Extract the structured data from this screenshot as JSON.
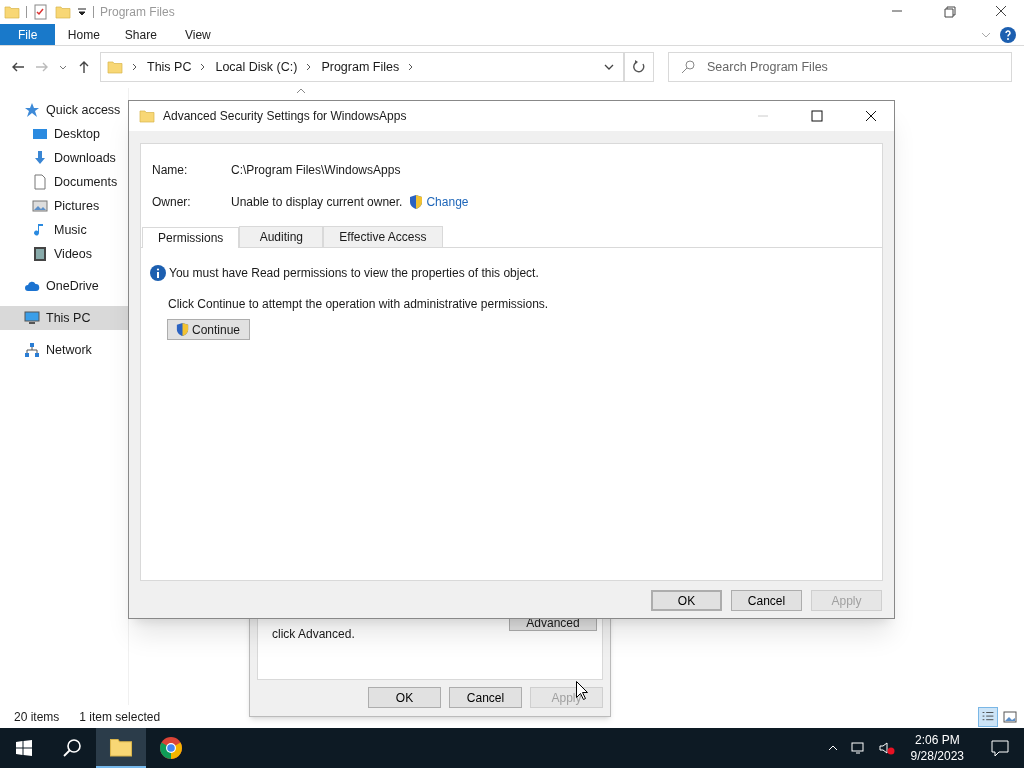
{
  "explorer": {
    "title": "Program Files",
    "ribbon_tabs": [
      {
        "label": "File",
        "selected": true
      },
      {
        "label": "Home",
        "selected": false
      },
      {
        "label": "Share",
        "selected": false
      },
      {
        "label": "View",
        "selected": false
      }
    ],
    "breadcrumb": [
      "This PC",
      "Local Disk (C:)",
      "Program Files"
    ],
    "search": {
      "placeholder": "Search Program Files"
    },
    "sidebar": [
      {
        "label": "Quick access",
        "kind": "star",
        "selected": false,
        "children": [
          {
            "label": "Desktop",
            "kind": "desktop",
            "selected": false
          },
          {
            "label": "Downloads",
            "kind": "download",
            "selected": false
          },
          {
            "label": "Documents",
            "kind": "document",
            "selected": false
          },
          {
            "label": "Pictures",
            "kind": "pictures",
            "selected": false
          },
          {
            "label": "Music",
            "kind": "music",
            "selected": false
          },
          {
            "label": "Videos",
            "kind": "video",
            "selected": false
          }
        ]
      },
      {
        "label": "OneDrive",
        "kind": "cloud",
        "selected": false
      },
      {
        "label": "This PC",
        "kind": "pc",
        "selected": true
      },
      {
        "label": "Network",
        "kind": "network",
        "selected": false
      }
    ],
    "status_bar": {
      "items": "20 items",
      "selection": "1 item selected"
    }
  },
  "properties_dialog": {
    "hint": "click Advanced.",
    "advanced_button": "Advanced",
    "buttons": [
      {
        "label": "OK",
        "disabled": false
      },
      {
        "label": "Cancel",
        "disabled": false
      },
      {
        "label": "Apply",
        "disabled": true
      }
    ]
  },
  "security_dialog": {
    "title": "Advanced Security Settings for WindowsApps",
    "name_label": "Name:",
    "name_value": "C:\\Program Files\\WindowsApps",
    "owner_label": "Owner:",
    "owner_value": "Unable to display current owner.",
    "change_link": "Change",
    "tabs": [
      {
        "label": "Permissions",
        "selected": true
      },
      {
        "label": "Auditing",
        "selected": false
      },
      {
        "label": "Effective Access",
        "selected": false
      }
    ],
    "info": "You must have Read permissions to view the properties of this object.",
    "instruction": "Click Continue to attempt the operation with administrative permissions.",
    "continue_button": "Continue",
    "buttons": [
      {
        "label": "OK",
        "disabled": false,
        "default": true
      },
      {
        "label": "Cancel",
        "disabled": false,
        "default": false
      },
      {
        "label": "Apply",
        "disabled": true,
        "default": false
      }
    ]
  },
  "taskbar": {
    "apps": [
      {
        "kind": "explorer",
        "active": true
      },
      {
        "kind": "chrome",
        "active": false
      }
    ],
    "time": "2:06 PM",
    "date": "9/28/2023"
  }
}
